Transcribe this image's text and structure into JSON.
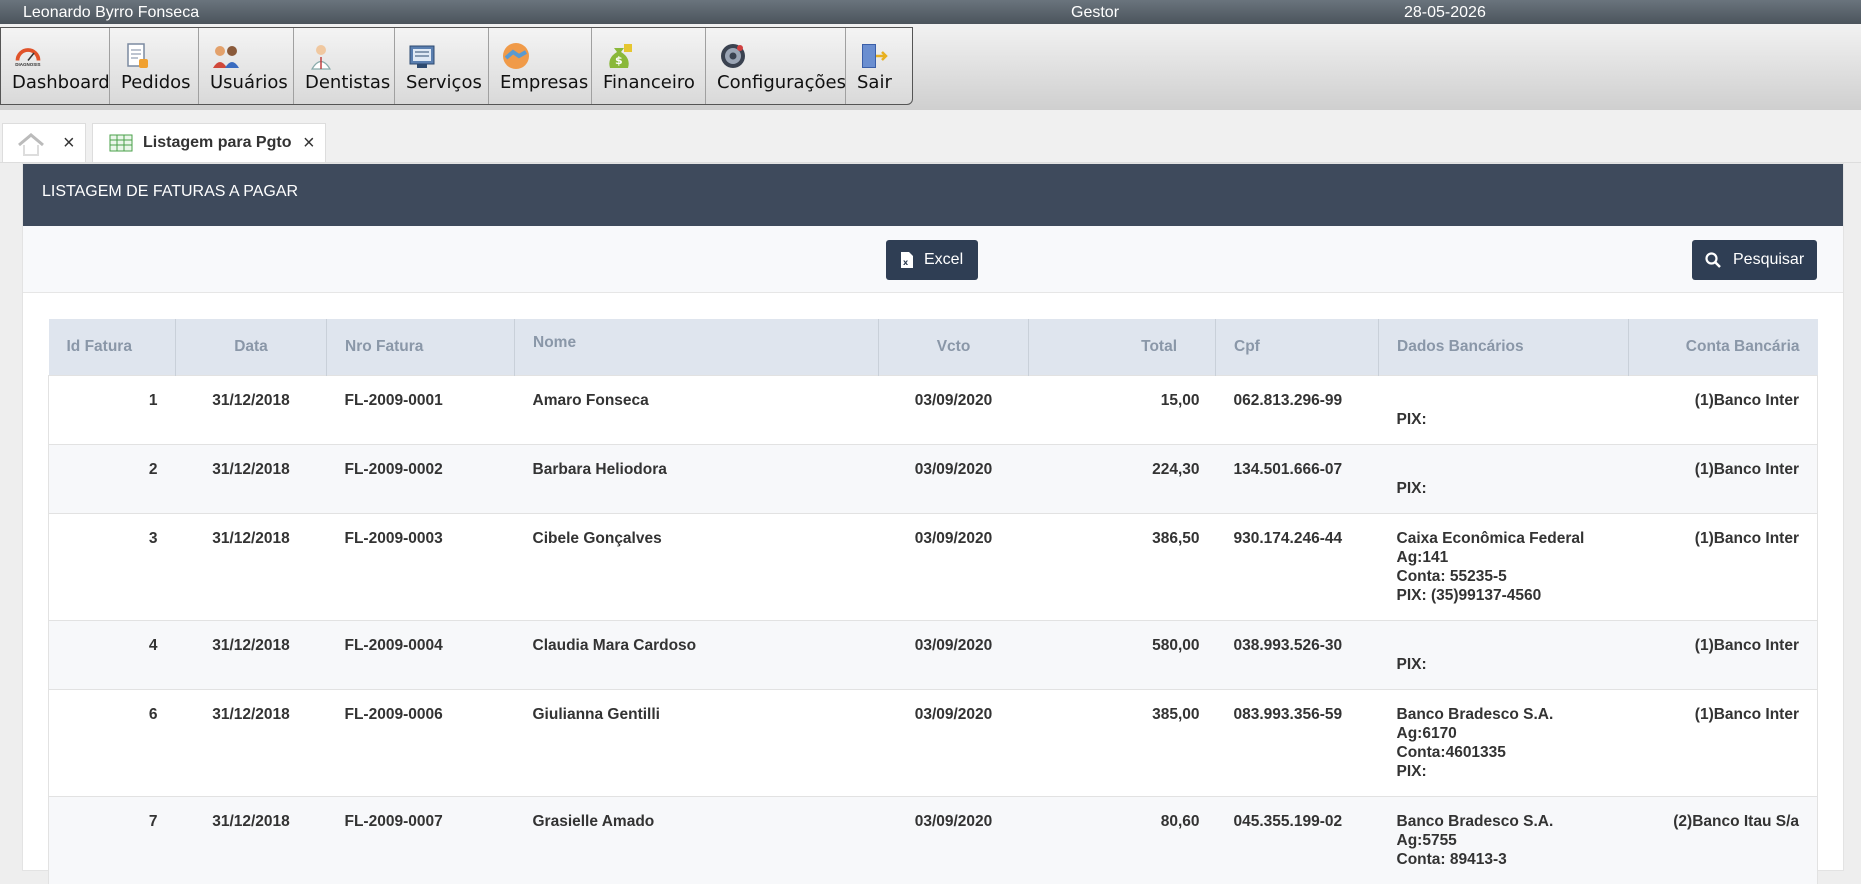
{
  "topbar": {
    "user": "Leonardo Byrro Fonseca",
    "role": "Gestor",
    "date": "28-05-2026"
  },
  "menu": [
    {
      "label": "Dashboard",
      "icon": "diagnosis-logo-icon"
    },
    {
      "label": "Pedidos",
      "icon": "orders-icon"
    },
    {
      "label": "Usuários",
      "icon": "users-icon"
    },
    {
      "label": "Dentistas",
      "icon": "dentist-icon"
    },
    {
      "label": "Serviços",
      "icon": "services-icon"
    },
    {
      "label": "Empresas",
      "icon": "handshake-icon"
    },
    {
      "label": "Financeiro",
      "icon": "money-bag-icon"
    },
    {
      "label": "Configurações",
      "icon": "settings-gear-icon"
    },
    {
      "label": "Sair",
      "icon": "exit-door-icon"
    }
  ],
  "tabs": {
    "home_close": "×",
    "active_label": "Listagem para Pgto",
    "active_close": "×"
  },
  "panel": {
    "title": "LISTAGEM DE FATURAS A PAGAR"
  },
  "toolbar": {
    "excel_label": "Excel",
    "search_label": "Pesquisar"
  },
  "table": {
    "headers": [
      "Id Fatura",
      "Data",
      "Nro Fatura",
      "Nome",
      "Vcto",
      "Total",
      "Cpf",
      "Dados Bancários",
      "Conta Bancária"
    ],
    "rows": [
      {
        "id": "1",
        "data": "31/12/2018",
        "nro": "FL-2009-0001",
        "nome": "Amaro Fonseca",
        "vcto": "03/09/2020",
        "total": "15,00",
        "cpf": "062.813.296-99",
        "dados": "\nPIX:",
        "conta": "(1)Banco Inter"
      },
      {
        "id": "2",
        "data": "31/12/2018",
        "nro": "FL-2009-0002",
        "nome": "Barbara Heliodora",
        "vcto": "03/09/2020",
        "total": "224,30",
        "cpf": "134.501.666-07",
        "dados": "\nPIX:",
        "conta": "(1)Banco Inter"
      },
      {
        "id": "3",
        "data": "31/12/2018",
        "nro": "FL-2009-0003",
        "nome": "Cibele Gonçalves",
        "vcto": "03/09/2020",
        "total": "386,50",
        "cpf": "930.174.246-44",
        "dados": "Caixa Econômica Federal\nAg:141\nConta: 55235-5\nPIX: (35)99137-4560",
        "conta": "(1)Banco Inter"
      },
      {
        "id": "4",
        "data": "31/12/2018",
        "nro": "FL-2009-0004",
        "nome": "Claudia Mara Cardoso",
        "vcto": "03/09/2020",
        "total": "580,00",
        "cpf": "038.993.526-30",
        "dados": "\nPIX:",
        "conta": "(1)Banco Inter"
      },
      {
        "id": "6",
        "data": "31/12/2018",
        "nro": "FL-2009-0006",
        "nome": "Giulianna Gentilli",
        "vcto": "03/09/2020",
        "total": "385,00",
        "cpf": "083.993.356-59",
        "dados": "Banco Bradesco S.A.\nAg:6170\nConta:4601335\nPIX:",
        "conta": "(1)Banco Inter"
      },
      {
        "id": "7",
        "data": "31/12/2018",
        "nro": "FL-2009-0007",
        "nome": "Grasielle Amado",
        "vcto": "03/09/2020",
        "total": "80,60",
        "cpf": "045.355.199-02",
        "dados": "Banco Bradesco S.A.\nAg:5755\nConta: 89413-3",
        "conta": "(2)Banco Itau S/a"
      }
    ]
  },
  "colors": {
    "topbar": "#555e66",
    "panel_header": "#3e4a5c",
    "button": "#2f3e54",
    "table_header": "#dfe5ee"
  }
}
